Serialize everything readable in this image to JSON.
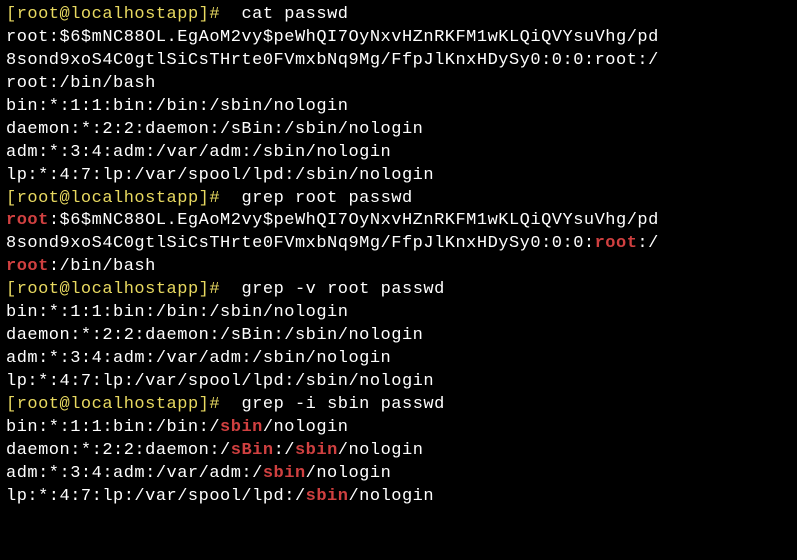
{
  "prompt": {
    "open": "[",
    "user": "root",
    "at": "@",
    "host": "localhost",
    "path": "app",
    "close": "]#",
    "space": " "
  },
  "commands": {
    "cmd1": "cat passwd",
    "cmd2": "grep root passwd",
    "cmd3": "grep -v root passwd",
    "cmd4": "grep -i sbin passwd"
  },
  "cat_output": {
    "line1": "root:$6$mNC88OL.EgAoM2vy$peWhQI7OyNxvHZnRKFM1wKLQiQVYsuVhg/pd",
    "line2": "8sond9xoS4C0gtlSiCsTHrte0FVmxbNq9Mg/FfpJlKnxHDySy0:0:0:root:/",
    "line3": "root:/bin/bash",
    "line4": "bin:*:1:1:bin:/bin:/sbin/nologin",
    "line5": "daemon:*:2:2:daemon:/sBin:/sbin/nologin",
    "line6": "adm:*:3:4:adm:/var/adm:/sbin/nologin",
    "line7": "lp:*:4:7:lp:/var/spool/lpd:/sbin/nologin"
  },
  "grep_root": {
    "l1_m1": "root",
    "l1_rest": ":$6$mNC88OL.EgAoM2vy$peWhQI7OyNxvHZnRKFM1wKLQiQVYsuVhg/pd",
    "l2_pre": "8sond9xoS4C0gtlSiCsTHrte0FVmxbNq9Mg/FfpJlKnxHDySy0:0:0:",
    "l2_m1": "root",
    "l2_post": ":/",
    "l3_m1": "root",
    "l3_rest": ":/bin/bash"
  },
  "grep_v_root": {
    "line1": "bin:*:1:1:bin:/bin:/sbin/nologin",
    "line2": "daemon:*:2:2:daemon:/sBin:/sbin/nologin",
    "line3": "adm:*:3:4:adm:/var/adm:/sbin/nologin",
    "line4": "lp:*:4:7:lp:/var/spool/lpd:/sbin/nologin"
  },
  "grep_i_sbin": {
    "l1_pre": "bin:*:1:1:bin:/bin:/",
    "l1_m": "sbin",
    "l1_post": "/nologin",
    "l2_pre": "daemon:*:2:2:daemon:/",
    "l2_m1": "sBin",
    "l2_mid": ":/",
    "l2_m2": "sbin",
    "l2_post": "/nologin",
    "l3_pre": "adm:*:3:4:adm:/var/adm:/",
    "l3_m": "sbin",
    "l3_post": "/nologin",
    "l4_pre": "lp:*:4:7:lp:/var/spool/lpd:/",
    "l4_m": "sbin",
    "l4_post": "/nologin"
  }
}
